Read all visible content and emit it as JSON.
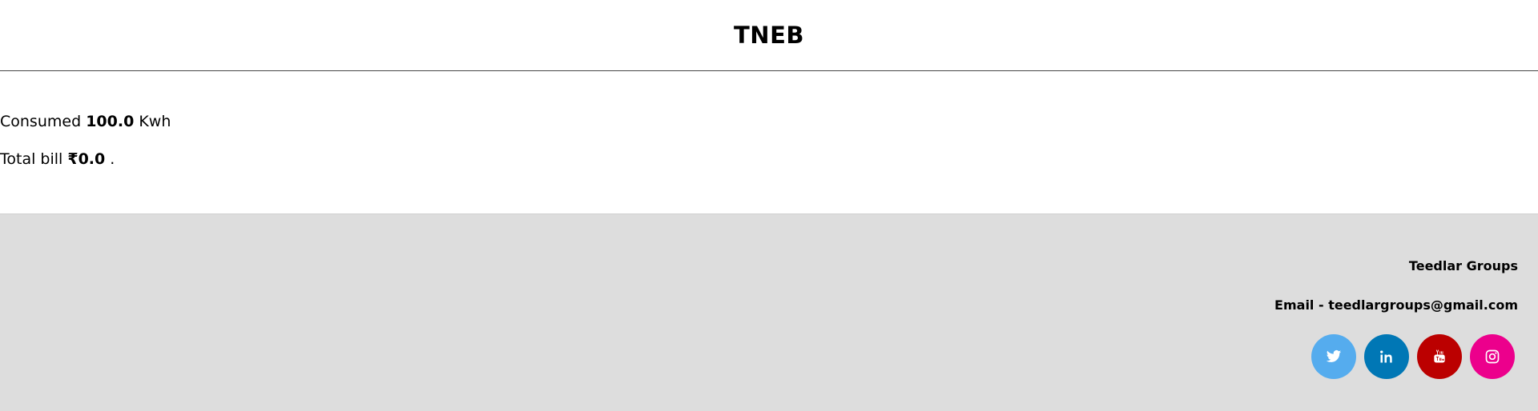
{
  "header": {
    "title": "TNEB"
  },
  "usage": {
    "consumed_prefix": "Consumed",
    "consumed_value": "100.0",
    "consumed_unit": "Kwh",
    "bill_prefix": "Total bill",
    "bill_value": "₹0.0",
    "bill_suffix": "."
  },
  "footer": {
    "company": "Teedlar Groups",
    "email_label": "Email",
    "email_sep": " - ",
    "email": "teedlargroups@gmail.com",
    "social": [
      {
        "icon": "twitter-icon",
        "color": "#55acee"
      },
      {
        "icon": "linkedin-icon",
        "color": "#0077b5"
      },
      {
        "icon": "youtube-icon",
        "color": "#bb0000"
      },
      {
        "icon": "instagram-icon",
        "color": "#ec008c"
      }
    ]
  }
}
